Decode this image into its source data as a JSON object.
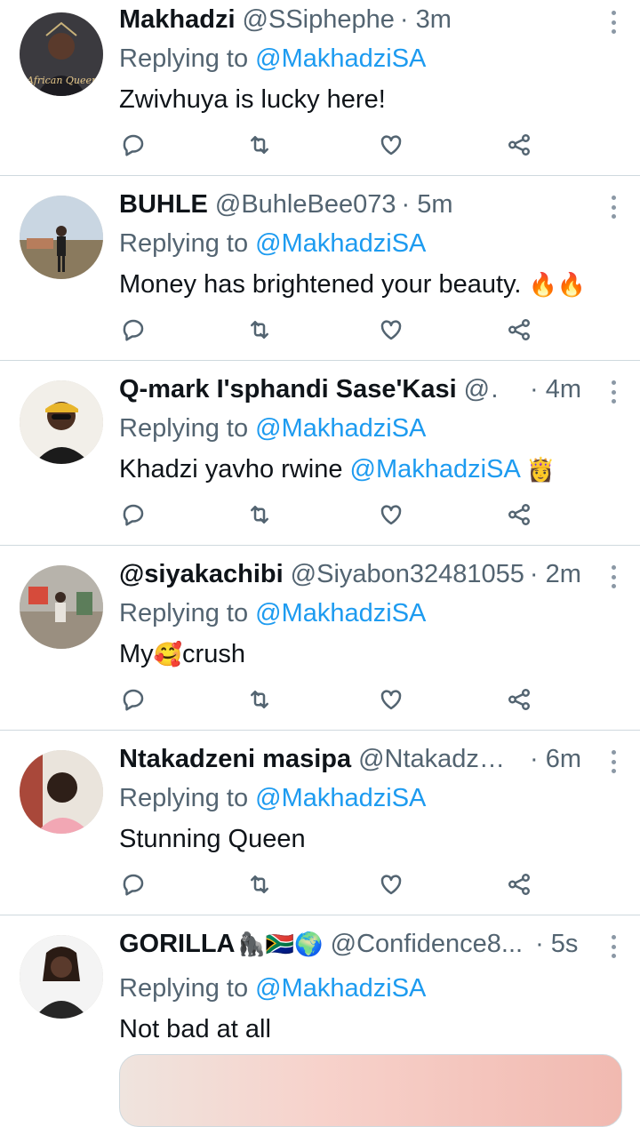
{
  "replying_prefix": "Replying to",
  "tweets": [
    {
      "name": "Makhadzi",
      "handle": "@SSiphephe",
      "time": "· 3m",
      "reply_to": "@MakhadziSA",
      "text": "Zwivhuya is lucky here!",
      "avatar_caption": "African Queen"
    },
    {
      "name": "BUHLE",
      "handle": "@BuhleBee073",
      "time": "· 5m",
      "reply_to": "@MakhadziSA",
      "text": "Money has brightened your beauty.",
      "emoji": "🔥🔥"
    },
    {
      "name": "Q-mark I'sphandi Sase'Kasi",
      "handle": "@...",
      "time": "· 4m",
      "reply_to": "@MakhadziSA",
      "text": "Khadzi yavho rwine",
      "text_mention": "@MakhadziSA",
      "emoji": "👸"
    },
    {
      "name": "@siyakachibi",
      "handle": "@Siyabon32481055",
      "time": "· 2m",
      "reply_to": "@MakhadziSA",
      "text": "My",
      "emoji": "🥰",
      "text_after": "crush"
    },
    {
      "name": "Ntakadzeni masipa",
      "handle": "@Ntakadze...",
      "time": "· 6m",
      "reply_to": "@MakhadziSA",
      "text": "Stunning Queen"
    },
    {
      "name": "GORILLA",
      "name_emoji": "🦍🇿🇦🌍",
      "handle": "@Confidence8...",
      "time": "· 5s",
      "reply_to": "@MakhadziSA",
      "text": "Not bad at all"
    }
  ],
  "icons": {
    "reply": "reply-icon",
    "retweet": "retweet-icon",
    "like": "heart-icon",
    "share": "share-icon",
    "more": "more-vertical-icon"
  },
  "colors": {
    "link": "#1d9bf0",
    "secondary_text": "#536471",
    "divider": "#cfd9de"
  }
}
